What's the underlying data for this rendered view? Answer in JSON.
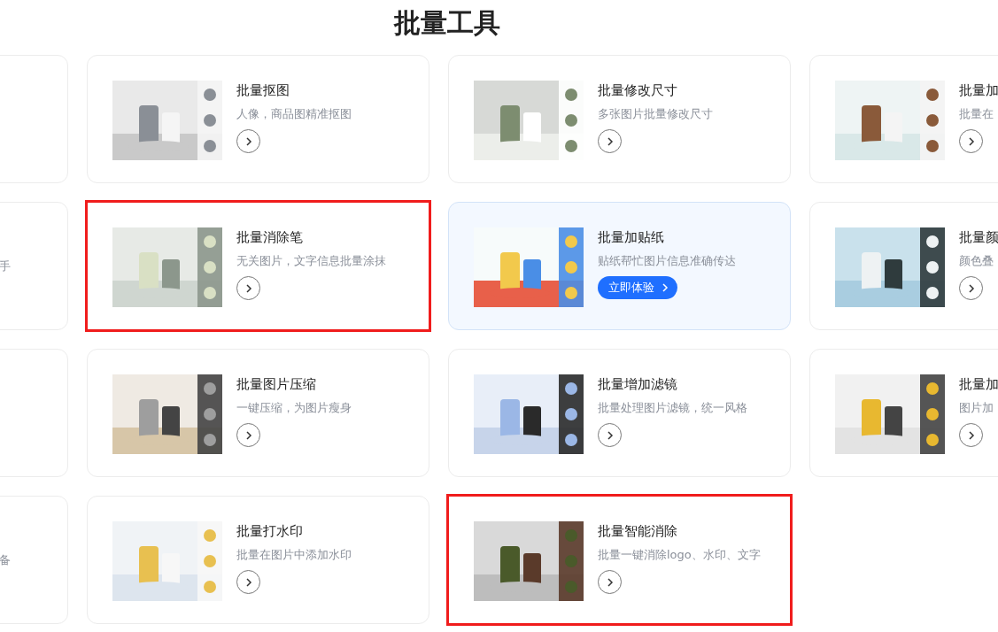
{
  "page_title": "批量工具",
  "rows": [
    {
      "cards": [
        {
          "kind": "cut_left"
        },
        {
          "kind": "full",
          "title": "批量抠图",
          "description": "人像，商品图精准抠图",
          "featured": false,
          "highlighted": false
        },
        {
          "kind": "full",
          "title": "批量修改尺寸",
          "description": "多张图片批量修改尺寸",
          "featured": false,
          "highlighted": false
        },
        {
          "kind": "cut_right",
          "title": "批量加",
          "description": "批量在"
        }
      ]
    },
    {
      "cards": [
        {
          "kind": "cut_left",
          "description": "手"
        },
        {
          "kind": "full",
          "title": "批量消除笔",
          "description": "无关图片，文字信息批量涂抹",
          "featured": false,
          "highlighted": true
        },
        {
          "kind": "full",
          "title": "批量加贴纸",
          "description": "贴纸帮忙图片信息准确传达",
          "featured": true,
          "button": "立即体验",
          "highlighted": false
        },
        {
          "kind": "cut_right",
          "title": "批量颜",
          "description": "颜色叠"
        }
      ]
    },
    {
      "cards": [
        {
          "kind": "cut_left"
        },
        {
          "kind": "full",
          "title": "批量图片压缩",
          "description": "一键压缩，为图片瘦身",
          "featured": false,
          "highlighted": false
        },
        {
          "kind": "full",
          "title": "批量增加滤镜",
          "description": "批量处理图片滤镜，统一风格",
          "featured": false,
          "highlighted": false
        },
        {
          "kind": "cut_right",
          "title": "批量加",
          "description": "图片加"
        }
      ]
    },
    {
      "cards": [
        {
          "kind": "cut_left",
          "description": "备"
        },
        {
          "kind": "full",
          "title": "批量打水印",
          "description": "批量在图片中添加水印",
          "featured": false,
          "highlighted": false
        },
        {
          "kind": "full",
          "title": "批量智能消除",
          "description": "批量一键消除logo、水印、文字",
          "featured": false,
          "highlighted": true
        }
      ]
    }
  ]
}
